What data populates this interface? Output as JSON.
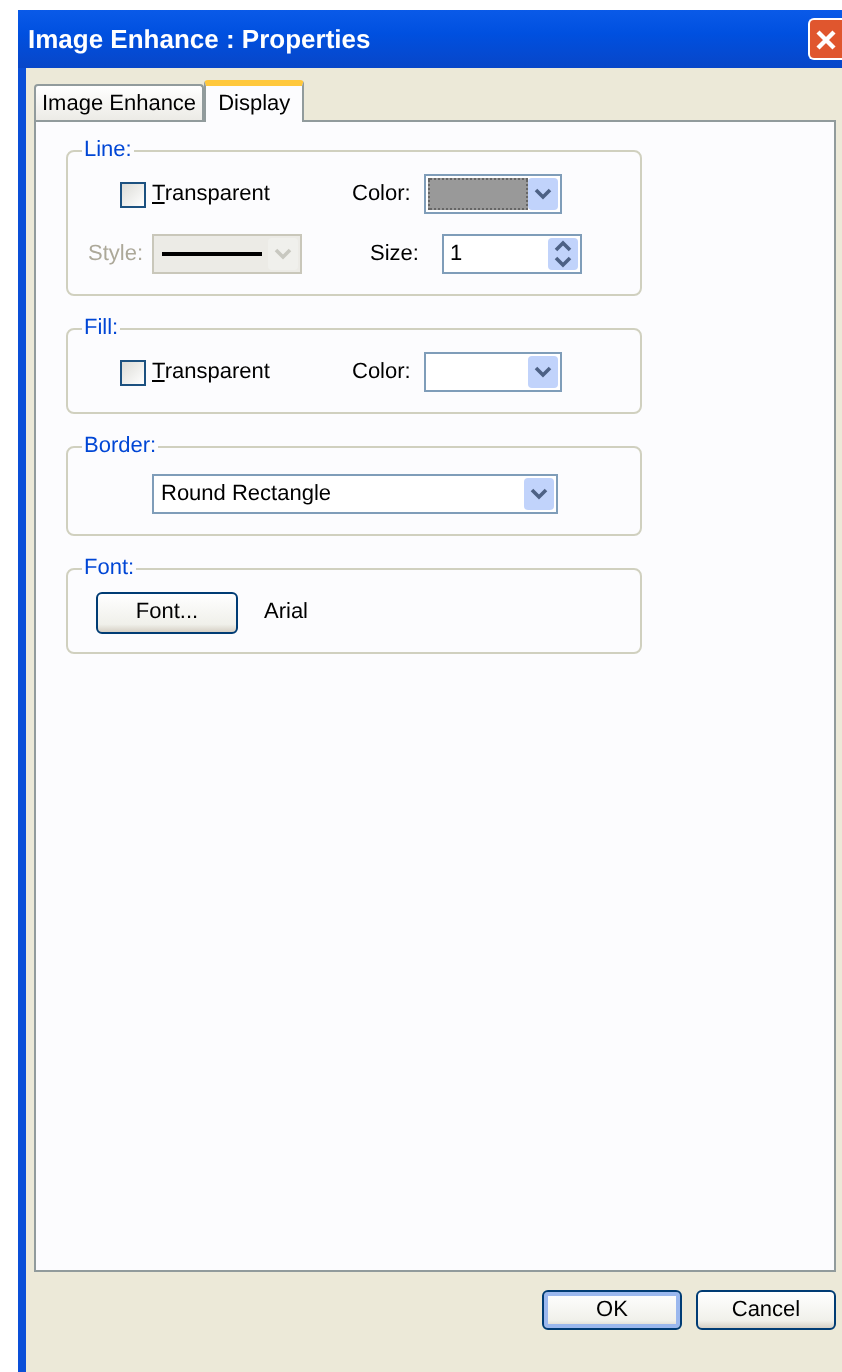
{
  "window": {
    "title": "Image Enhance :  Properties"
  },
  "tabs": [
    {
      "label": "Image Enhance",
      "selected": false
    },
    {
      "label": "Display",
      "selected": true
    }
  ],
  "line": {
    "legend": "Line:",
    "transparent": {
      "label": "Transparent",
      "checked": false
    },
    "color_label": "Color:",
    "color": "#999999",
    "style_label": "Style:",
    "style_disabled": true,
    "size_label": "Size:",
    "size_value": "1"
  },
  "fill": {
    "legend": "Fill:",
    "transparent": {
      "label": "Transparent",
      "checked": false
    },
    "color_label": "Color:",
    "color": "#ffffff"
  },
  "border": {
    "legend": "Border:",
    "value": "Round Rectangle"
  },
  "font": {
    "legend": "Font:",
    "button": "Font...",
    "name": "Arial"
  },
  "buttons": [
    {
      "label": "OK",
      "default": true
    },
    {
      "label": "Cancel",
      "default": false
    }
  ]
}
